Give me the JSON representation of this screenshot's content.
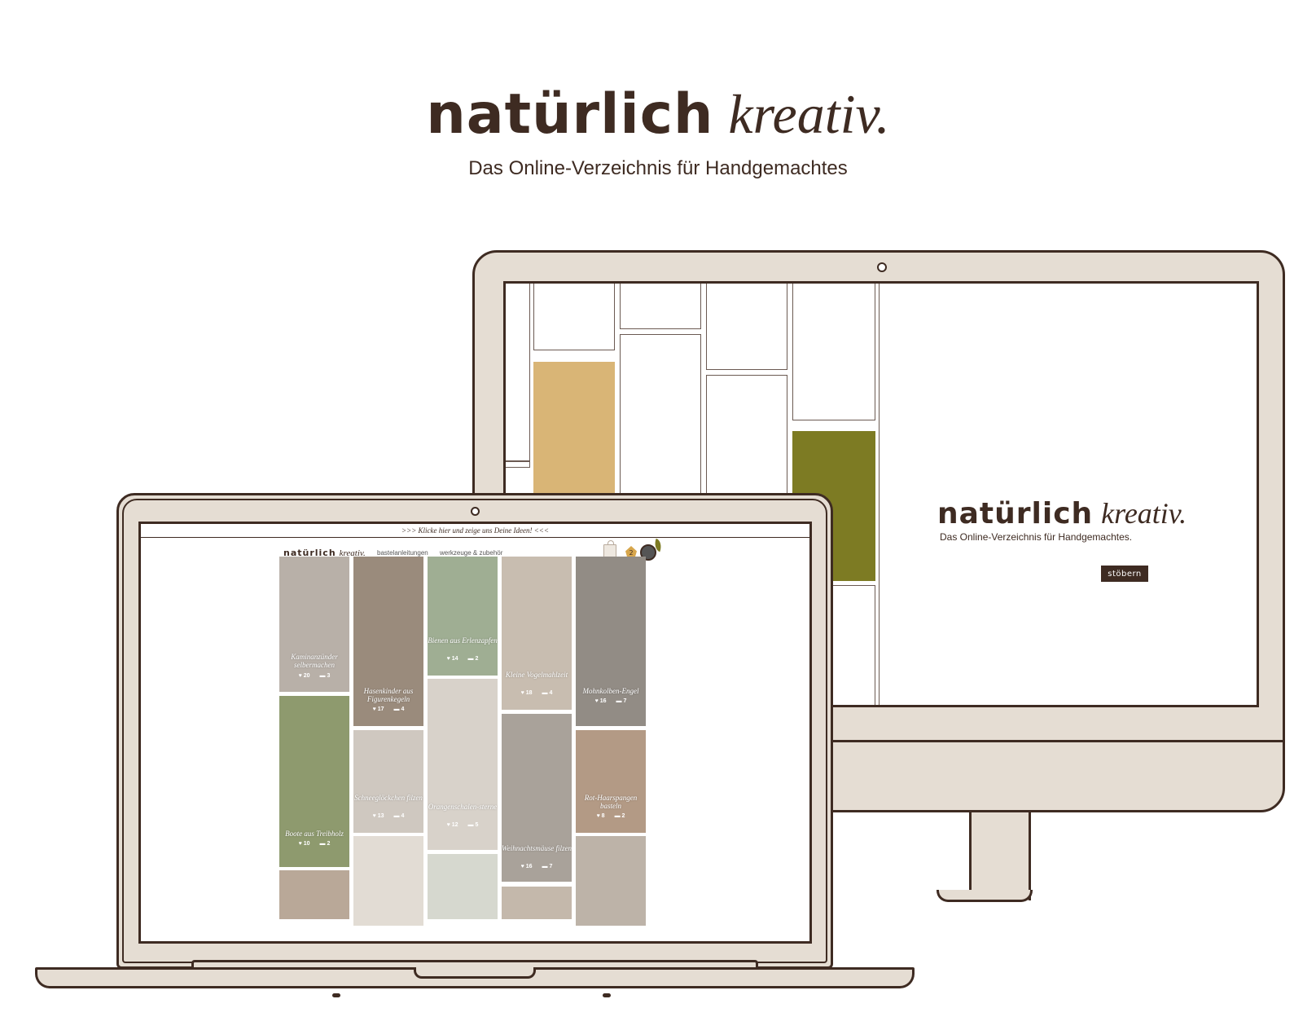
{
  "header": {
    "brand_bold": "natürlich",
    "brand_italic": "kreativ.",
    "tagline": "Das Online-Verzeichnis für Handgemachtes"
  },
  "desktop": {
    "brand_bold": "natürlich",
    "brand_italic": "kreativ.",
    "tagline": "Das Online-Verzeichnis für Handgemachtes.",
    "cta": "stöbern",
    "colors": {
      "tan": "#d9b576",
      "olive": "#7d7b23",
      "frame": "#e5ddd3",
      "ink": "#3e2b22"
    }
  },
  "laptop": {
    "promo": ">>> Klicke hier und zeige uns Deine Ideen! <<<",
    "brand_bold": "natürlich",
    "brand_italic": "kreativ.",
    "nav": [
      "bastelanleitungen",
      "werkzeuge & zubehör"
    ],
    "cart_icon": "shopping-bag-icon",
    "badge_count": "2",
    "cards": [
      {
        "title": "Kaminanzünder selbermachen",
        "likes": "20",
        "comments": "3",
        "color": "#b8b0a8"
      },
      {
        "title": "Hasenkinder aus Figurenkegeln",
        "likes": "17",
        "comments": "4",
        "color": "#9a8b7c"
      },
      {
        "title": "Bienen aus Erlenzapfen",
        "likes": "14",
        "comments": "2",
        "color": "#9fae93"
      },
      {
        "title": "Kleine Vogelmahlzeit",
        "likes": "18",
        "comments": "4",
        "color": "#c8bdb0"
      },
      {
        "title": "Mohnkolben-Engel",
        "likes": "16",
        "comments": "7",
        "color": "#928c85"
      },
      {
        "title": "Boote aus Treibholz",
        "likes": "10",
        "comments": "2",
        "color": "#8e9a6e"
      },
      {
        "title": "Schneeglöckchen filzen",
        "likes": "13",
        "comments": "4",
        "color": "#cfc8c0"
      },
      {
        "title": "Orangenschalen-sterne",
        "likes": "12",
        "comments": "5",
        "color": "#d8d2ca"
      },
      {
        "title": "Weihnachtsmäuse filzen",
        "likes": "16",
        "comments": "7",
        "color": "#a9a29a"
      },
      {
        "title": "Rot-Haarspangen basteln",
        "likes": "8",
        "comments": "2",
        "color": "#b39a85"
      }
    ]
  }
}
